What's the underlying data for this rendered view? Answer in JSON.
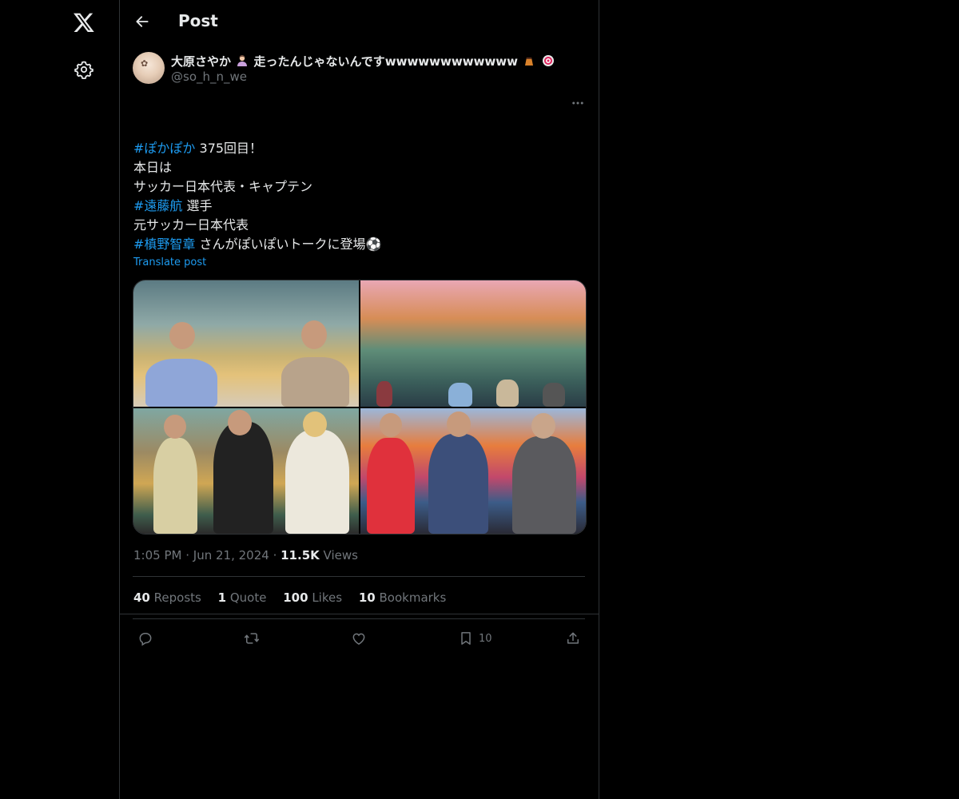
{
  "page": {
    "title": "Post"
  },
  "post": {
    "display_name": "大原さやか",
    "display_name_suffix": "走ったんじゃないんですwwwwwwwwwwww",
    "handle": "@so_h_n_we",
    "lines": [
      {
        "tag": "#ぽかぽか",
        "text": " 375回目！"
      },
      {
        "tag": "",
        "text": "本日は"
      },
      {
        "tag": "",
        "text": "サッカー日本代表・キャプテン"
      },
      {
        "tag": "#遠藤航",
        "text": " 選手"
      },
      {
        "tag": "",
        "text": "元サッカー日本代表"
      },
      {
        "tag": "#槙野智章",
        "text": " さんがぽいぽいトークに登場⚽"
      }
    ],
    "translate": "Translate post",
    "time": "1:05 PM",
    "date": "Jun 21, 2024",
    "views_count": "11.5K",
    "views_label": "Views",
    "stats": {
      "reposts_count": "40",
      "reposts_label": "Reposts",
      "quote_count": "1",
      "quote_label": "Quote",
      "likes_count": "100",
      "likes_label": "Likes",
      "bookmarks_count": "10",
      "bookmarks_label": "Bookmarks"
    },
    "actions": {
      "bookmark_count": "10"
    }
  },
  "colors": {
    "background": "#000000",
    "accent": "#1d9bf0",
    "muted": "#71767b",
    "text": "#e7e9ea",
    "border": "#2f3336"
  },
  "icons": [
    "x-logo-icon",
    "gear-icon",
    "back-arrow-icon",
    "more-icon",
    "reply-icon",
    "repost-icon",
    "like-icon",
    "bookmark-icon",
    "share-icon"
  ]
}
